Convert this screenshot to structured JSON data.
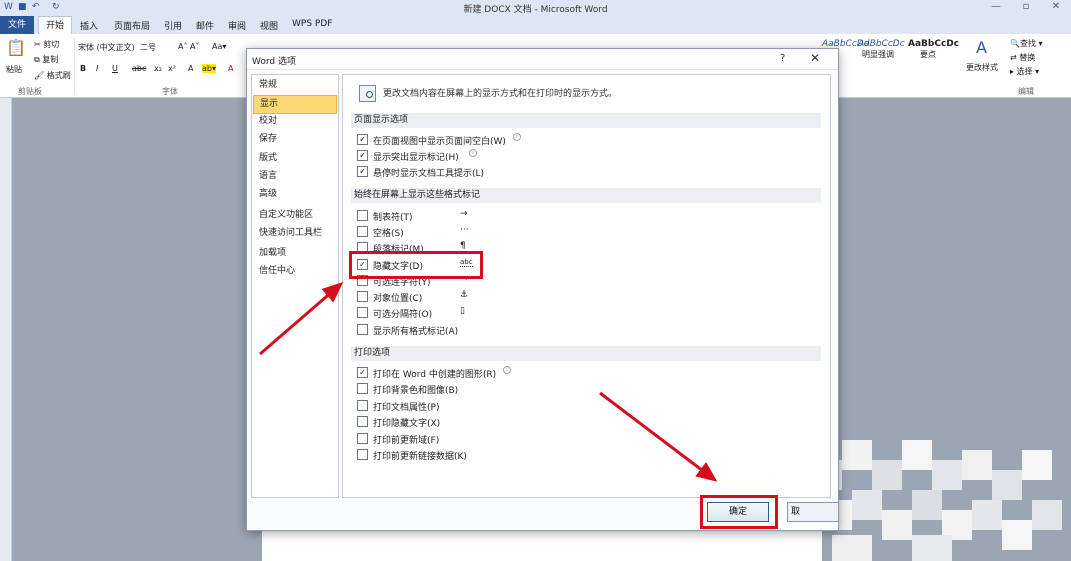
{
  "window": {
    "title": "新建 DOCX 文档 - Microsoft Word"
  },
  "ribbon_tabs": [
    "文件",
    "开始",
    "插入",
    "页面布局",
    "引用",
    "邮件",
    "审阅",
    "视图",
    "WPS PDF"
  ],
  "ribbon": {
    "paste": "粘贴",
    "cut": "剪切",
    "copy": "复制",
    "format_painter": "格式刷",
    "clipboard_group": "剪贴板",
    "font_name": "宋体 (中文正文)",
    "font_size": "二号",
    "font_group": "字体",
    "styles": [
      {
        "preview": "AaBbCcDd",
        "name": ""
      },
      {
        "preview": "AaBbCcDc",
        "name": "明显强调"
      },
      {
        "preview": "AaBbCcDc",
        "name": "要点"
      }
    ],
    "change_styles": "更改样式",
    "find": "查找",
    "replace": "替换",
    "select": "选择",
    "edit_group": "编辑"
  },
  "dialog": {
    "title": "Word 选项",
    "help": "?",
    "close": "✕",
    "nav": [
      "常规",
      "显示",
      "校对",
      "保存",
      "版式",
      "语言",
      "高级",
      "自定义功能区",
      "快速访问工具栏",
      "加载项",
      "信任中心"
    ],
    "nav_selected": "显示",
    "intro": "更改文档内容在屏幕上的显示方式和在打印时的显示方式。",
    "sections": {
      "page_display": {
        "title": "页面显示选项",
        "items": [
          {
            "label": "在页面视图中显示页面间空白(W)",
            "checked": true,
            "info": true
          },
          {
            "label": "显示突出显示标记(H)",
            "checked": true,
            "info": true
          },
          {
            "label": "悬停时显示文档工具提示(L)",
            "checked": true,
            "info": false
          }
        ]
      },
      "format_marks": {
        "title": "始终在屏幕上显示这些格式标记",
        "items": [
          {
            "label": "制表符(T)",
            "checked": false,
            "symbol": "→"
          },
          {
            "label": "空格(S)",
            "checked": false,
            "symbol": "···"
          },
          {
            "label": "段落标记(M)",
            "checked": false,
            "symbol": "¶"
          },
          {
            "label": "隐藏文字(D)",
            "checked": true,
            "symbol": "abc"
          },
          {
            "label": "可选连字符(Y)",
            "checked": false,
            "symbol": "¬"
          },
          {
            "label": "对象位置(C)",
            "checked": false,
            "symbol": "⚓"
          },
          {
            "label": "可选分隔符(O)",
            "checked": false,
            "symbol": "▯"
          },
          {
            "label": "显示所有格式标记(A)",
            "checked": false,
            "symbol": ""
          }
        ]
      },
      "print": {
        "title": "打印选项",
        "items": [
          {
            "label": "打印在 Word 中创建的图形(R)",
            "checked": true,
            "info": true
          },
          {
            "label": "打印背景色和图像(B)",
            "checked": false,
            "info": false
          },
          {
            "label": "打印文档属性(P)",
            "checked": false,
            "info": false
          },
          {
            "label": "打印隐藏文字(X)",
            "checked": false,
            "info": false
          },
          {
            "label": "打印前更新域(F)",
            "checked": false,
            "info": false
          },
          {
            "label": "打印前更新链接数据(K)",
            "checked": false,
            "info": false
          }
        ]
      }
    },
    "ok": "确定",
    "cancel": "取"
  },
  "colors": {
    "highlight": "#d40f1d",
    "accent": "#2b579a"
  }
}
